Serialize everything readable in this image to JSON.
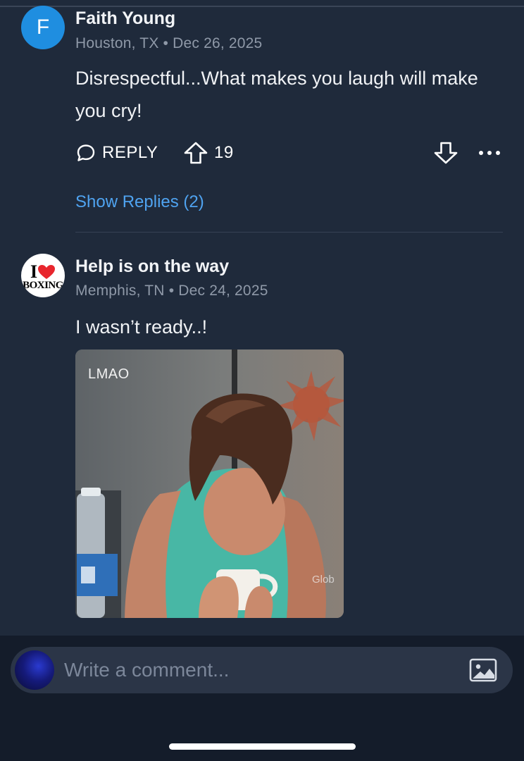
{
  "comments": [
    {
      "avatar_letter": "F",
      "author": "Faith Young",
      "location": "Houston, TX",
      "separator": "•",
      "date": "Dec 26, 2025",
      "text": "Disrespectful...What makes you laugh will make you cry!",
      "reply_label": "REPLY",
      "upvotes": "19",
      "show_replies": "Show Replies (2)"
    },
    {
      "avatar_icon": "i-love-boxing-logo",
      "avatar_logo_text": [
        "I",
        "BOXING"
      ],
      "author": "Help is on the way",
      "location": "Memphis, TN",
      "separator": "•",
      "date": "Dec 24, 2025",
      "text": "I wasn’t ready..!",
      "gif_label": "LMAO",
      "gif_watermark": "Glob"
    }
  ],
  "icons": {
    "reply": "chat-bubble-icon",
    "upvote": "arrow-up-outline-icon",
    "downvote": "arrow-down-outline-icon",
    "more": "ellipsis-icon",
    "attach_image": "image-icon"
  },
  "composer": {
    "placeholder": "Write a comment..."
  },
  "colors": {
    "background": "#1f2a3b",
    "link": "#4fa3f0",
    "avatar_blue": "#1f8ee0",
    "muted": "#8f99a8"
  }
}
